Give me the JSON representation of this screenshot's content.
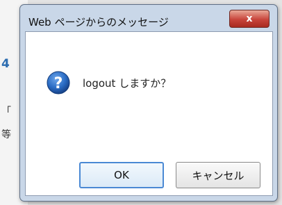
{
  "background": {
    "fragments": [
      "4",
      "「",
      "等"
    ]
  },
  "dialog": {
    "title": "Web ページからのメッセージ",
    "close_label": "x",
    "message": "logout しますか？",
    "ok_label": "OK",
    "cancel_label": "キャンセル",
    "icon": "question-icon"
  },
  "colors": {
    "frame": "#c9d7e8",
    "close_button": "#c8443b",
    "icon_blue": "#1f5fb0",
    "ok_border": "#4a89d4"
  }
}
